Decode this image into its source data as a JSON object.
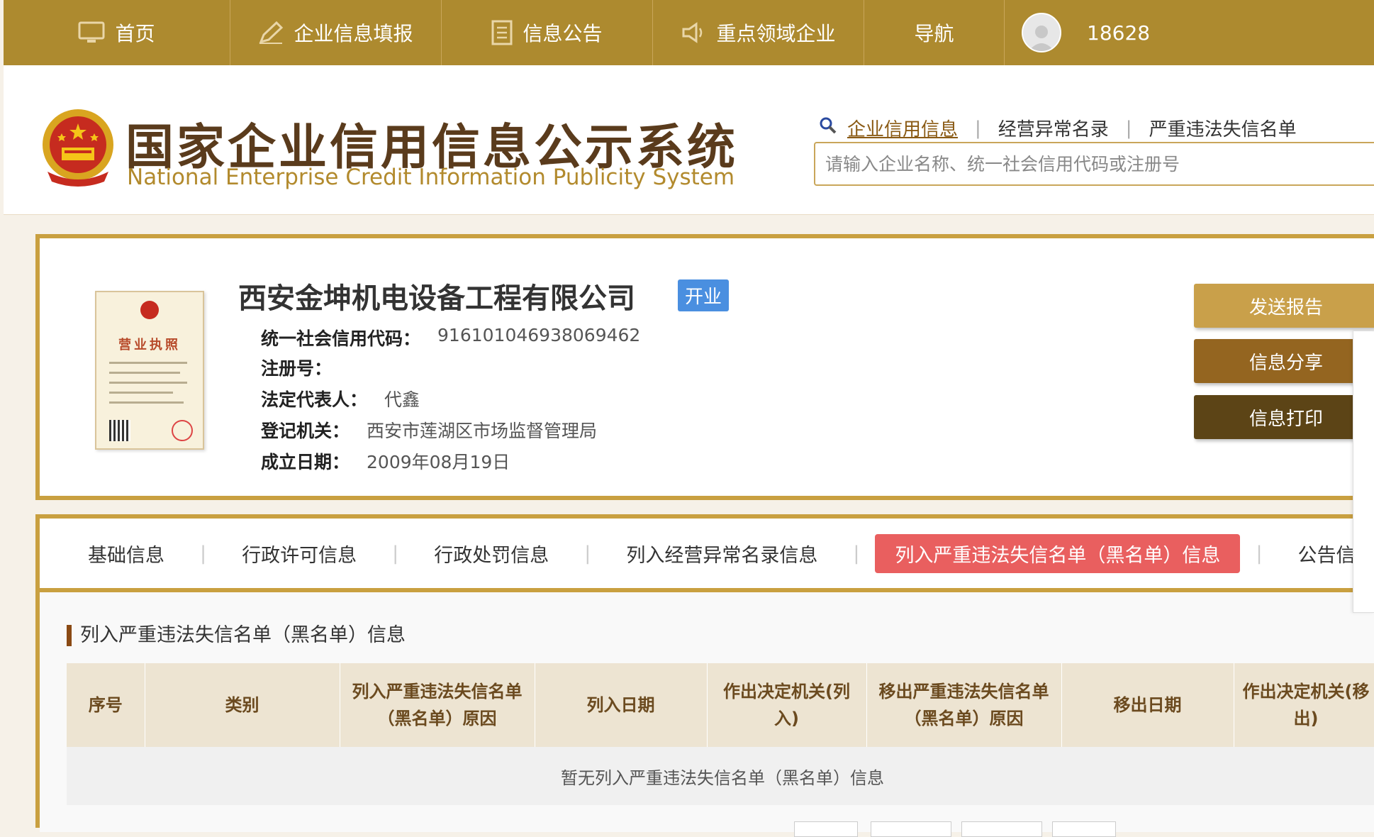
{
  "nav": {
    "items": [
      {
        "label": "首页",
        "icon": "monitor-icon"
      },
      {
        "label": "企业信息填报",
        "icon": "pen-icon"
      },
      {
        "label": "信息公告",
        "icon": "document-icon"
      },
      {
        "label": "重点领域企业",
        "icon": "speaker-icon"
      },
      {
        "label": "导航",
        "icon": ""
      }
    ],
    "user_phone": "18628"
  },
  "header": {
    "title_cn": "国家企业信用信息公示系统",
    "title_en": "National Enterprise Credit Information Publicity System",
    "search_links": [
      "企业信用信息",
      "经营异常名录",
      "严重违法失信名单"
    ],
    "search_placeholder": "请输入企业名称、统一社会信用代码或注册号"
  },
  "company": {
    "name": "西安金坤机电设备工程有限公司",
    "status": "开业",
    "license_title": "营业执照",
    "fields": [
      {
        "label": "统一社会信用代码：",
        "value": "916101046938069462"
      },
      {
        "label": "注册号：",
        "value": ""
      },
      {
        "label": "法定代表人：",
        "value": "代鑫"
      },
      {
        "label": "登记机关：",
        "value": "西安市莲湖区市场监督管理局"
      },
      {
        "label": "成立日期：",
        "value": "2009年08月19日"
      }
    ],
    "actions": [
      {
        "label": "发送报告",
        "color": "#c9a04a"
      },
      {
        "label": "信息分享",
        "color": "#946520"
      },
      {
        "label": "信息打印",
        "color": "#5c4416"
      }
    ]
  },
  "tabs": [
    {
      "label": "基础信息"
    },
    {
      "label": "行政许可信息"
    },
    {
      "label": "行政处罚信息"
    },
    {
      "label": "列入经营异常名录信息"
    },
    {
      "label": "列入严重违法失信名单（黑名单）信息",
      "active": true
    },
    {
      "label": "公告信息"
    }
  ],
  "section": {
    "title": "列入严重违法失信名单（黑名单）信息",
    "columns": [
      "序号",
      "类别",
      "列入严重违法失信名单（黑名单）原因",
      "列入日期",
      "作出决定机关(列入)",
      "移出严重违法失信名单（黑名单）原因",
      "移出日期",
      "作出决定机关(移出)"
    ],
    "empty_text": "暂无列入严重违法失信名单（黑名单）信息"
  },
  "colors": {
    "nav_bg": "#ad8a2f",
    "accent_border": "#c9a040",
    "active_tab": "#e95f5f",
    "status_badge": "#4a8fe0"
  }
}
